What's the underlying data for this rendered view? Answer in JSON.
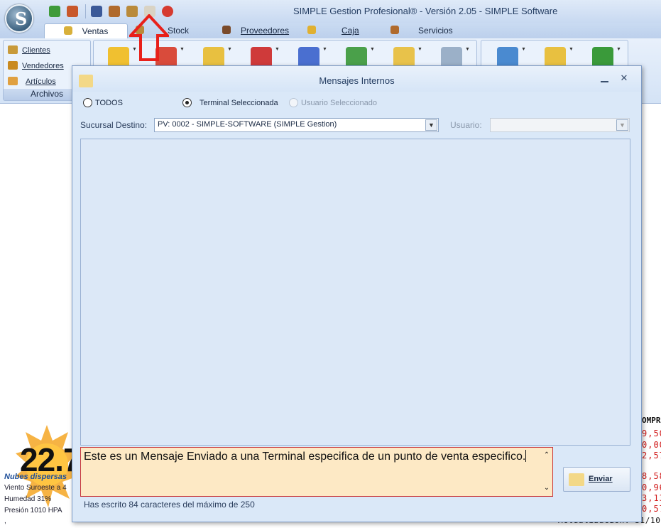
{
  "app": {
    "title": "SIMPLE Gestion Profesional® - Versión 2.05 - SIMPLE Software",
    "logo_letter": "S"
  },
  "quick_access": [
    {
      "icon": "refresh-green-icon",
      "color": "#3f9b3a"
    },
    {
      "icon": "user-fire-icon",
      "color": "#c8572a"
    },
    {
      "icon": "facebook-icon",
      "color": "#3b5998"
    },
    {
      "icon": "user-support-icon",
      "color": "#b06a2c"
    },
    {
      "icon": "book-icon",
      "color": "#b98a3a"
    },
    {
      "icon": "messages-icon",
      "color": "#d9d3c4"
    },
    {
      "icon": "lifebuoy-icon",
      "color": "#d63b30"
    }
  ],
  "tabs": [
    {
      "label": "Ventas",
      "active": true,
      "icon_color": "#d8b03a"
    },
    {
      "label": "Stock",
      "active": false,
      "icon_color": "#b98a3a"
    },
    {
      "label": "Proveedores",
      "active": false,
      "icon_color": "#7a4a2a"
    },
    {
      "label": "Caja",
      "active": false,
      "icon_color": "#e0b030"
    },
    {
      "label": "Servicios",
      "active": false,
      "icon_color": "#b06a2c"
    }
  ],
  "ribbon": {
    "archivos": {
      "caption": "Archivos",
      "items": [
        {
          "label": "Clientes",
          "icon_color": "#c89a3a"
        },
        {
          "label": "Vendedores",
          "icon_color": "#c98a20"
        },
        {
          "label": "Artículos",
          "icon_color": "#e0a040"
        }
      ]
    },
    "buttons_group1": [
      {
        "icon": "sales-star-icon",
        "color": "#f0c030"
      },
      {
        "icon": "store-icon",
        "color": "#d94b3b"
      },
      {
        "icon": "register-star-icon",
        "color": "#e8c040"
      },
      {
        "icon": "brush-red-icon",
        "color": "#cf3a3a"
      },
      {
        "icon": "brush-blue-icon",
        "color": "#4a6fd0"
      },
      {
        "icon": "cash-register-icon",
        "color": "#4aa04a"
      },
      {
        "icon": "folder-money-icon",
        "color": "#e8c24a"
      },
      {
        "icon": "clock-icon",
        "color": "#9bb0c8"
      }
    ],
    "buttons_group2": [
      {
        "icon": "document-gear-icon",
        "color": "#4a8ad0"
      },
      {
        "icon": "document-star-icon",
        "color": "#e8c040"
      },
      {
        "icon": "dollar-sign-icon",
        "color": "#3a9a3a"
      }
    ]
  },
  "weather": {
    "temperature": "22.7",
    "condition": "Nubes dispersas",
    "wind": "Viento Suroeste a 4",
    "humidity": "Humedad 31%",
    "pressure": "Presión 1010 HPA",
    "extra": ","
  },
  "ticker": {
    "header": "OMPR",
    "values": [
      "9,50",
      "0,00",
      "2,57",
      "8,58",
      "0,96",
      "3,13",
      "0,57"
    ],
    "update": "Actualización: 31/10/"
  },
  "dialog": {
    "title": "Mensajes Internos",
    "close_glyph": "✕",
    "radio_all": "TODOS",
    "radio_terminal": "Terminal Seleccionada",
    "radio_user": "Usuario Seleccionado",
    "branch_label": "Sucursal Destino:",
    "branch_value": "PV: 0002 - SIMPLE-SOFTWARE (SIMPLE Gestion)",
    "user_label": "Usuario:",
    "user_value": "",
    "message_text": "Este es un Mensaje Enviado a una Terminal especifica de un punto de venta especifico.",
    "send_label": "Enviar",
    "char_count": "Has escrito 84 caracteres del máximo de 250"
  },
  "colors": {
    "highlight_arrow": "#e8201a",
    "message_bg": "#fde9c5",
    "message_border": "#c8373c",
    "ticker_red": "#d11a1a"
  }
}
